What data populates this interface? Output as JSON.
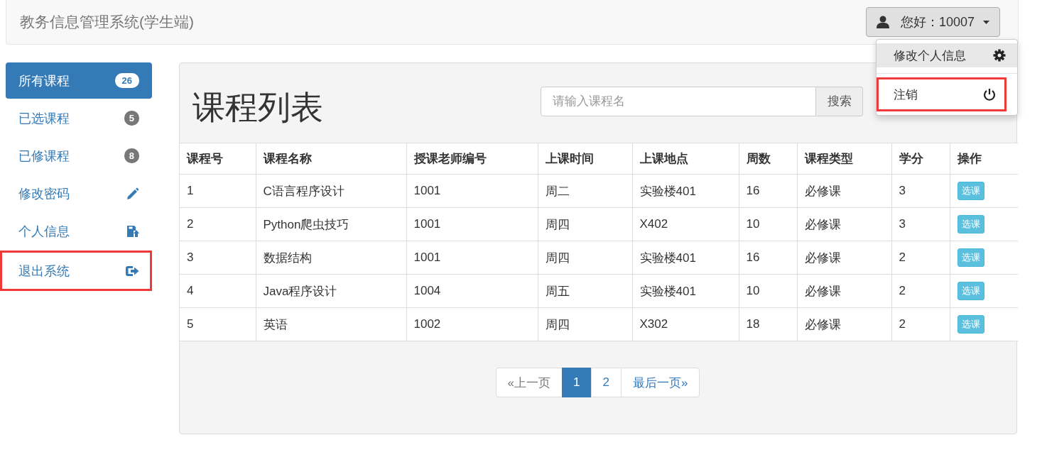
{
  "navbar": {
    "brand": "教务信息管理系统(学生端)",
    "user_button": "您好：10007",
    "dropdown": [
      {
        "label": "修改个人信息",
        "selected": true,
        "outlined": false
      },
      {
        "label": "注销",
        "selected": false,
        "outlined": true
      }
    ]
  },
  "sidebar": {
    "items": [
      {
        "label": "所有课程",
        "kind": "badge",
        "badge": "26",
        "selected": true,
        "outlined": false
      },
      {
        "label": "已选课程",
        "kind": "badge",
        "badge": "5",
        "selected": false,
        "outlined": false
      },
      {
        "label": "已修课程",
        "kind": "badge",
        "badge": "8",
        "selected": false,
        "outlined": false
      },
      {
        "label": "修改密码",
        "kind": "icon",
        "selected": false,
        "outlined": false
      },
      {
        "label": "个人信息",
        "kind": "icon",
        "selected": false,
        "outlined": false
      },
      {
        "label": "退出系统",
        "kind": "icon",
        "selected": false,
        "outlined": true
      }
    ]
  },
  "panel": {
    "title": "课程列表",
    "search": {
      "placeholder": "请输入课程名",
      "button": "搜索"
    }
  },
  "table": {
    "columns": [
      "课程号",
      "课程名称",
      "授课老师编号",
      "上课时间",
      "上课地点",
      "周数",
      "课程类型",
      "学分",
      "操作"
    ],
    "rows": [
      {
        "cells": [
          "1",
          "C语言程序设计",
          "1001",
          "周二",
          "实验楼401",
          "16",
          "必修课",
          "3"
        ],
        "action": "选课"
      },
      {
        "cells": [
          "2",
          "Python爬虫技巧",
          "1001",
          "周四",
          "X402",
          "10",
          "必修课",
          "3"
        ],
        "action": "选课"
      },
      {
        "cells": [
          "3",
          "数据结构",
          "1001",
          "周四",
          "实验楼401",
          "16",
          "必修课",
          "2"
        ],
        "action": "选课"
      },
      {
        "cells": [
          "4",
          "Java程序设计",
          "1004",
          "周五",
          "实验楼401",
          "10",
          "必修课",
          "2"
        ],
        "action": "选课"
      },
      {
        "cells": [
          "5",
          "英语",
          "1002",
          "周四",
          "X302",
          "18",
          "必修课",
          "2"
        ],
        "action": "选课"
      }
    ]
  },
  "pagination": [
    {
      "label": "«上一页",
      "selected": false,
      "disabled": true
    },
    {
      "label": "1",
      "selected": true,
      "disabled": false
    },
    {
      "label": "2",
      "selected": false,
      "disabled": false
    },
    {
      "label": "最后一页»",
      "selected": false,
      "disabled": false
    }
  ]
}
